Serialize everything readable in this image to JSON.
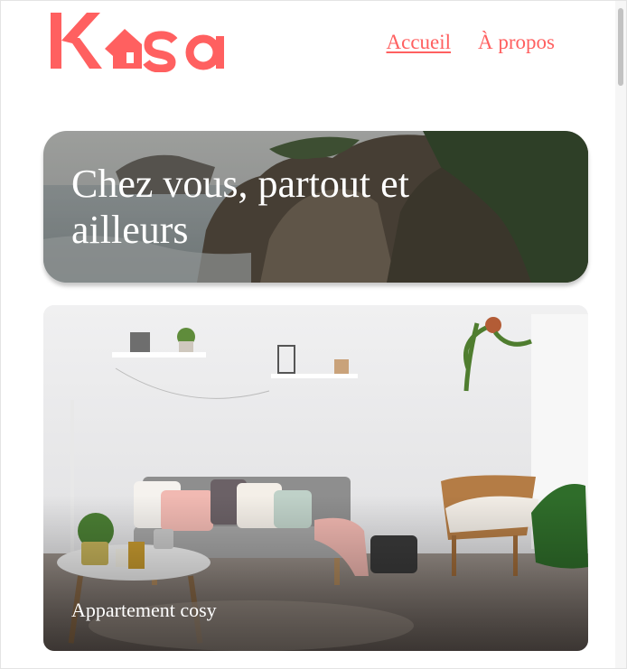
{
  "header": {
    "logo_text": "Kasa",
    "nav": [
      {
        "label": "Accueil",
        "active": true
      },
      {
        "label": "À propos",
        "active": false
      }
    ]
  },
  "banner": {
    "title": "Chez vous, partout et ailleurs"
  },
  "cards": [
    {
      "title": "Appartement cosy"
    }
  ],
  "colors": {
    "brand": "#ff6060",
    "text_on_image": "#ffffff"
  }
}
